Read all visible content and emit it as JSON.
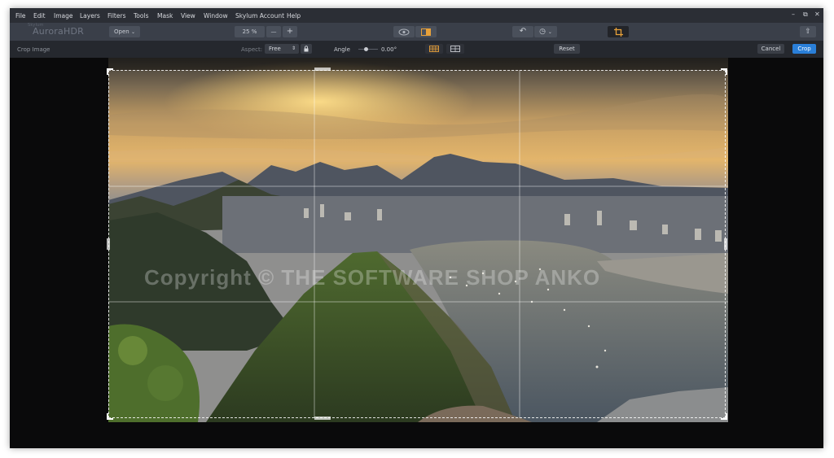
{
  "menubar": {
    "items": [
      "File",
      "Edit",
      "Image",
      "Layers",
      "Filters",
      "Tools",
      "Mask",
      "View",
      "Window",
      "Skylum Account",
      "Help"
    ]
  },
  "window_controls": {
    "minimize": "–",
    "restore": "⧉",
    "close": "✕"
  },
  "toolbar": {
    "logo": "AuroraHDR",
    "logo_small": "Skylum",
    "open_label": "Open",
    "zoom_value": "25 %",
    "zoom_out": "—",
    "zoom_in": "+",
    "undo_icon": "↶",
    "history_icon": "◷",
    "history_caret": "⌄",
    "share_icon": "⇧"
  },
  "crop_options": {
    "title": "Crop Image",
    "aspect_label": "Aspect:",
    "aspect_value": "Free",
    "angle_label": "Angle",
    "angle_value": "0.00°",
    "reset_label": "Reset",
    "cancel_label": "Cancel",
    "crop_label": "Crop"
  },
  "canvas": {
    "watermark": "Copyright © THE SOFTWARE SHOP  ANKO"
  },
  "colors": {
    "accent_blue": "#2a7fd8",
    "crop_icon_orange": "#e8a13a",
    "menubar_bg": "#2b2e35",
    "toolbar_bg": "#3a3f49"
  }
}
